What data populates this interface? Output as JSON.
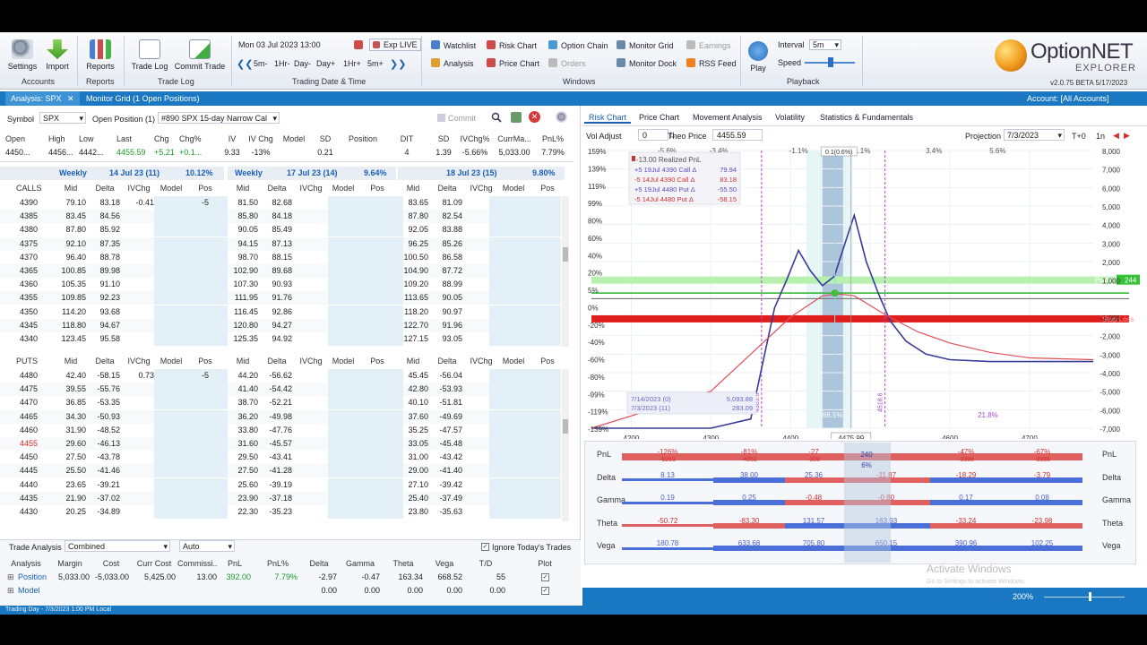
{
  "ribbon": {
    "settings": "Settings",
    "import": "Import",
    "reports": "Reports",
    "trade_log": "Trade Log",
    "commit_trade": "Commit Trade",
    "groups": {
      "accounts": "Accounts",
      "reports": "Reports",
      "trade_log": "Trade Log",
      "trading_date_time": "Trading Date & Time",
      "windows": "Windows",
      "playback": "Playback"
    },
    "datetime": "Mon 03 Jul 2023 13:00",
    "exp_live": "Exp LIVE",
    "steps": [
      "5m-",
      "1Hr-",
      "Day-",
      "Day+",
      "1Hr+",
      "5m+"
    ],
    "windows": [
      "Watchlist",
      "Risk Chart",
      "Option Chain",
      "Monitor Grid",
      "Earnings",
      "Analysis",
      "Price Chart",
      "Orders",
      "Monitor Dock",
      "RSS Feed"
    ],
    "play": "Play",
    "interval_label": "Interval",
    "interval_value": "5m",
    "speed_label": "Speed",
    "logo_title": "OptionNET",
    "logo_sub": "EXPLORER",
    "version": "v2.0.75 BETA 5/17/2023"
  },
  "tabs": {
    "analysis": "Analysis: SPX",
    "close": "✕",
    "monitor": "Monitor Grid (1 Open Positions)",
    "account": "Account: [All Accounts]"
  },
  "toolbar": {
    "symbol_label": "Symbol",
    "symbol": "SPX",
    "open_position_label": "Open Position (1)",
    "position": "#890 SPX 15-day Narrow Cal",
    "commit": "Commit"
  },
  "quote": {
    "headers": [
      "Open",
      "High",
      "Low",
      "Last",
      "Chg",
      "Chg%",
      "IV",
      "IV Chg",
      "Model",
      "SD",
      "Position",
      "DIT",
      "SD",
      "IVChg%",
      "CurrMa...",
      "PnL%"
    ],
    "values": [
      "4450...",
      "4456...",
      "4442...",
      "4455.59",
      "+5.21",
      "+0.1...",
      "9.33",
      "-13%",
      "",
      "0.21",
      "",
      "4",
      "1.39",
      "-5.66%",
      "5,033.00",
      "7.79%"
    ]
  },
  "expiries": [
    {
      "label": "Weekly",
      "date": "14 Jul 23 (11)",
      "iv": "10.12%"
    },
    {
      "label": "Weekly",
      "date": "17 Jul 23 (14)",
      "iv": "9.64%"
    },
    {
      "label": "",
      "date": "18 Jul 23 (15)",
      "iv": "9.80%"
    }
  ],
  "calls_label": "CALLS",
  "puts_label": "PUTS",
  "col_headers": [
    "Mid",
    "Delta",
    "IVChg",
    "Model",
    "Pos"
  ],
  "calls": [
    {
      "k": "4390",
      "a": [
        "79.10",
        "83.18",
        "-0.41",
        "",
        "-5"
      ],
      "b": [
        "81.50",
        "82.68"
      ],
      "c": [
        "83.65",
        "81.09"
      ]
    },
    {
      "k": "4385",
      "a": [
        "83.45",
        "84.56",
        "",
        "",
        ""
      ],
      "b": [
        "85.80",
        "84.18"
      ],
      "c": [
        "87.80",
        "82.54"
      ]
    },
    {
      "k": "4380",
      "a": [
        "87.80",
        "85.92",
        "",
        "",
        ""
      ],
      "b": [
        "90.05",
        "85.49"
      ],
      "c": [
        "92.05",
        "83.88"
      ]
    },
    {
      "k": "4375",
      "a": [
        "92.10",
        "87.35",
        "",
        "",
        ""
      ],
      "b": [
        "94.15",
        "87.13"
      ],
      "c": [
        "96.25",
        "85.26"
      ]
    },
    {
      "k": "4370",
      "a": [
        "96.40",
        "88.78",
        "",
        "",
        ""
      ],
      "b": [
        "98.70",
        "88.15"
      ],
      "c": [
        "100.50",
        "86.58"
      ]
    },
    {
      "k": "4365",
      "a": [
        "100.85",
        "89.98",
        "",
        "",
        ""
      ],
      "b": [
        "102.90",
        "89.68"
      ],
      "c": [
        "104.90",
        "87.72"
      ]
    },
    {
      "k": "4360",
      "a": [
        "105.35",
        "91.10",
        "",
        "",
        ""
      ],
      "b": [
        "107.30",
        "90.93"
      ],
      "c": [
        "109.20",
        "88.99"
      ]
    },
    {
      "k": "4355",
      "a": [
        "109.85",
        "92.23",
        "",
        "",
        ""
      ],
      "b": [
        "111.95",
        "91.76"
      ],
      "c": [
        "113.65",
        "90.05"
      ]
    },
    {
      "k": "4350",
      "a": [
        "114.20",
        "93.68",
        "",
        "",
        ""
      ],
      "b": [
        "116.45",
        "92.86"
      ],
      "c": [
        "118.20",
        "90.97"
      ]
    },
    {
      "k": "4345",
      "a": [
        "118.80",
        "94.67",
        "",
        "",
        ""
      ],
      "b": [
        "120.80",
        "94.27"
      ],
      "c": [
        "122.70",
        "91.96"
      ]
    },
    {
      "k": "4340",
      "a": [
        "123.45",
        "95.58",
        "",
        "",
        ""
      ],
      "b": [
        "125.35",
        "94.92"
      ],
      "c": [
        "127.15",
        "93.05"
      ]
    }
  ],
  "puts": [
    {
      "k": "4480",
      "a": [
        "42.40",
        "-58.15",
        "0.73",
        "",
        "-5"
      ],
      "b": [
        "44.20",
        "-56.62"
      ],
      "c": [
        "45.45",
        "-56.04"
      ]
    },
    {
      "k": "4475",
      "a": [
        "39.55",
        "-55.76",
        "",
        "",
        ""
      ],
      "b": [
        "41.40",
        "-54.42"
      ],
      "c": [
        "42.80",
        "-53.93"
      ]
    },
    {
      "k": "4470",
      "a": [
        "36.85",
        "-53.35",
        "",
        "",
        ""
      ],
      "b": [
        "38.70",
        "-52.21"
      ],
      "c": [
        "40.10",
        "-51.81"
      ]
    },
    {
      "k": "4465",
      "a": [
        "34.30",
        "-50.93",
        "",
        "",
        ""
      ],
      "b": [
        "36.20",
        "-49.98"
      ],
      "c": [
        "37.60",
        "-49.69"
      ]
    },
    {
      "k": "4460",
      "a": [
        "31.90",
        "-48.52",
        "",
        "",
        ""
      ],
      "b": [
        "33.80",
        "-47.76"
      ],
      "c": [
        "35.25",
        "-47.57"
      ]
    },
    {
      "k": "4455",
      "a": [
        "29.60",
        "-46.13",
        "",
        "",
        ""
      ],
      "b": [
        "31.60",
        "-45.57"
      ],
      "c": [
        "33.05",
        "-45.48"
      ]
    },
    {
      "k": "4450",
      "a": [
        "27.50",
        "-43.78",
        "",
        "",
        ""
      ],
      "b": [
        "29.50",
        "-43.41"
      ],
      "c": [
        "31.00",
        "-43.42"
      ]
    },
    {
      "k": "4445",
      "a": [
        "25.50",
        "-41.46",
        "",
        "",
        ""
      ],
      "b": [
        "27.50",
        "-41.28"
      ],
      "c": [
        "29.00",
        "-41.40"
      ]
    },
    {
      "k": "4440",
      "a": [
        "23.65",
        "-39.21",
        "",
        "",
        ""
      ],
      "b": [
        "25.60",
        "-39.19"
      ],
      "c": [
        "27.10",
        "-39.42"
      ]
    },
    {
      "k": "4435",
      "a": [
        "21.90",
        "-37.02",
        "",
        "",
        ""
      ],
      "b": [
        "23.90",
        "-37.18"
      ],
      "c": [
        "25.40",
        "-37.49"
      ]
    },
    {
      "k": "4430",
      "a": [
        "20.25",
        "-34.89",
        "",
        "",
        ""
      ],
      "b": [
        "22.30",
        "-35.23"
      ],
      "c": [
        "23.80",
        "-35.63"
      ]
    }
  ],
  "analysis": {
    "title": "Trade Analysis",
    "mode": "Combined",
    "auto": "Auto",
    "ignore": "Ignore Today's Trades",
    "headers": [
      "Analysis",
      "Margin",
      "Cost",
      "Curr Cost",
      "Commissi...",
      "PnL",
      "PnL%",
      "Delta",
      "Gamma",
      "Theta",
      "Vega",
      "T/D",
      "Plot"
    ],
    "position": [
      "Position",
      "5,033.00",
      "-5,033.00",
      "5,425.00",
      "13.00",
      "392.00",
      "7.79%",
      "-2.97",
      "-0.47",
      "163.34",
      "668.52",
      "55",
      ""
    ],
    "model": [
      "Model",
      "",
      "",
      "",
      "",
      "",
      "",
      "0.00",
      "0.00",
      "0.00",
      "0.00",
      "0.00",
      ""
    ]
  },
  "right": {
    "tabs": [
      "Risk Chart",
      "Price Chart",
      "Movement Analysis",
      "Volatility",
      "Statistics & Fundamentals"
    ],
    "vol_adjust": "Vol Adjust",
    "vol_value": "0",
    "theo_price": "Theo Price",
    "theo_value": "4455.59",
    "projection": "Projection",
    "projection_date": "7/3/2023",
    "tplus": "T+0",
    "ln": "1n"
  },
  "chart_data": {
    "type": "line",
    "x_range": [
      4150,
      4780
    ],
    "xticks": [
      4200,
      4300,
      4400,
      4500,
      4600,
      4700
    ],
    "xtick_labels": [
      "4200",
      "4300",
      "4400",
      "",
      "4600",
      "4700"
    ],
    "crosshair_label": "4475.99",
    "pct_top": [
      "-5.6%",
      "-3.4%",
      "-1.1%",
      "1.1%",
      "3.4%",
      "5.6%"
    ],
    "pct_top_highlight": "0.1(0.6%)",
    "y_left": [
      "159%",
      "139%",
      "119%",
      "99%",
      "80%",
      "60%",
      "40%",
      "20%",
      "5%",
      "0%",
      "-20%",
      "-40%",
      "-60%",
      "-80%",
      "-99%",
      "-119%",
      "-139%"
    ],
    "y_right": [
      "8,000",
      "7,000",
      "6,000",
      "5,000",
      "4,000",
      "3,000",
      "2,000",
      "1,000",
      "",
      "-1,000",
      "-2,000",
      "-3,000",
      "-4,000",
      "-5,000",
      "-6,000",
      "-7,000"
    ],
    "ylim": [
      -7000,
      8000
    ],
    "legend": {
      "realized": "-13.00 Realized PnL",
      "items": [
        {
          "text": "+5 19Jul 4390 Call Δ",
          "val": "79.94",
          "color": "#5b4fbf"
        },
        {
          "text": "-5 14Jul 4390 Call Δ",
          "val": "83.18",
          "color": "#d03030"
        },
        {
          "text": "+5 19Jul 4480 Put Δ",
          "val": "-55.50",
          "color": "#5b4fbf"
        },
        {
          "text": "-5 14Jul 4480 Put Δ",
          "val": "-58.15",
          "color": "#d03030"
        }
      ]
    },
    "date_box": [
      {
        "date": "7/14/2023 (0)",
        "val": "5,093.88"
      },
      {
        "date": "7/3/2023 (11)",
        "val": "283.09"
      }
    ],
    "breakeven_labels": [
      "4363.6",
      "4518.6"
    ],
    "prob_labels": [
      "68.5%",
      "21.8%"
    ],
    "profit_target": "Profit Target",
    "profit_value": "244",
    "stop_loss": "Stop Loss",
    "series": [
      {
        "name": "7/14/2023 (0)",
        "color": "#3a3a9a",
        "x": [
          4150,
          4300,
          4350,
          4380,
          4395,
          4410,
          4425,
          4440,
          4455,
          4470,
          4480,
          4495,
          4510,
          4525,
          4545,
          4570,
          4600,
          4650,
          4700,
          4780
        ],
        "y": [
          -7000,
          -7000,
          -6500,
          -500,
          1000,
          2600,
          1500,
          700,
          1200,
          3200,
          4500,
          2000,
          300,
          -1200,
          -2300,
          -3000,
          -3300,
          -3400,
          -3400,
          -3400
        ]
      },
      {
        "name": "7/3/2023 (11)",
        "color": "#e0505a",
        "x": [
          4150,
          4300,
          4350,
          4400,
          4440,
          4460,
          4480,
          4520,
          4560,
          4600,
          4650,
          4700,
          4780
        ],
        "y": [
          -7000,
          -5000,
          -3000,
          -1000,
          150,
          250,
          150,
          -900,
          -1800,
          -2400,
          -2900,
          -3200,
          -3300
        ]
      }
    ],
    "greeks": {
      "rows": [
        "PnL",
        "Delta",
        "Gamma",
        "Theta",
        "Vega"
      ],
      "values": [
        [
          "-126%",
          "-81%",
          "-27",
          "",
          "-47%",
          "-67%"
        ],
        [
          "8.13",
          "38.00",
          "25.36",
          "-11.87",
          "-18.29",
          "-3.79"
        ],
        [
          "0.19",
          "0.25",
          "-0.48",
          "-0.80",
          "0.17",
          "0.08"
        ],
        [
          "-50.72",
          "-83.30",
          "131.57",
          "163.93",
          "-33.24",
          "-23.98"
        ],
        [
          "180.78",
          "633.68",
          "705.80",
          "650.15",
          "390.96",
          "102.25"
        ]
      ],
      "sub": [
        "-6263",
        "-4052",
        "-308",
        "",
        "-3388",
        "-3386"
      ],
      "center": [
        "240",
        "6%"
      ]
    },
    "zoom": "200%",
    "watermark": "Activate Windows",
    "watermark_sub": "Go to Settings to activate Windows."
  },
  "status": "Trading Day - 7/3/2023 1:00 PM Local"
}
